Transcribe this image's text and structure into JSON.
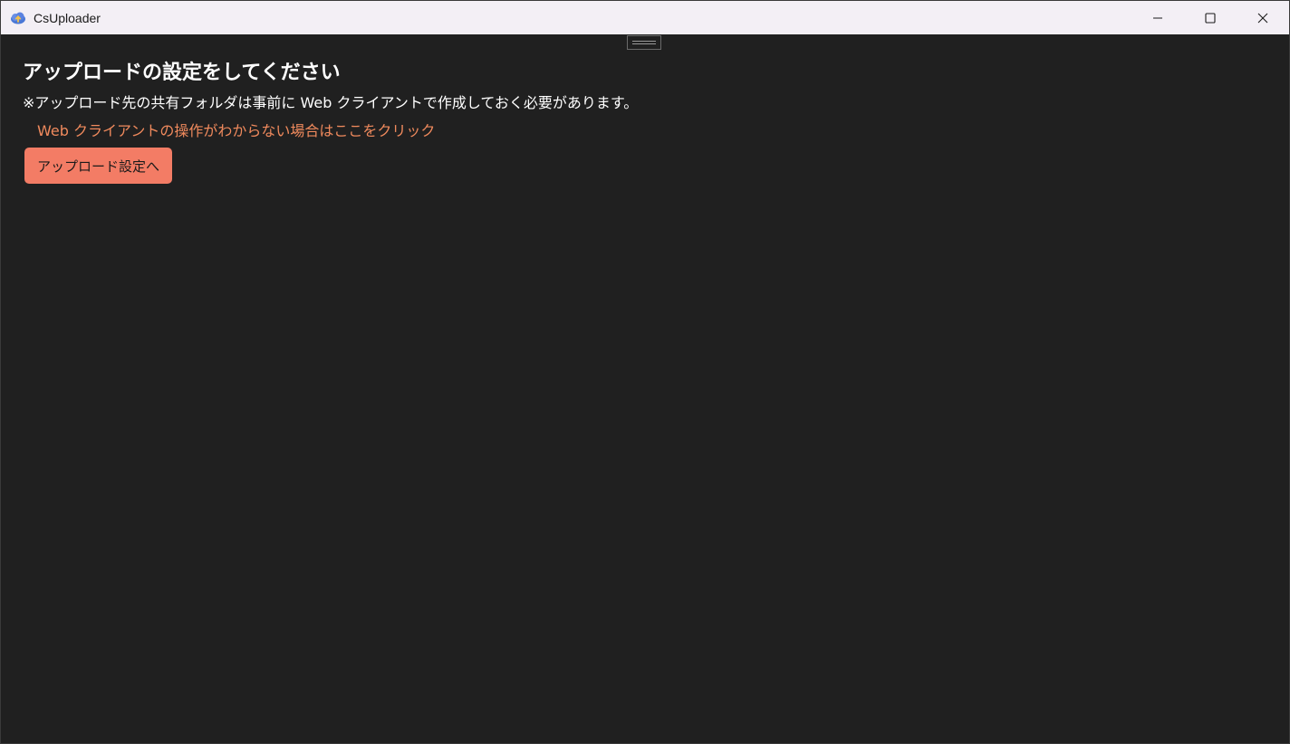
{
  "window": {
    "title": "CsUploader",
    "icon": "cloud-upload-icon",
    "controls": {
      "minimize": "minimize-icon",
      "maximize": "maximize-icon",
      "close": "close-icon"
    }
  },
  "main": {
    "heading": "アップロードの設定をしてください",
    "note": "※アップロード先の共有フォルダは事前に Web クライアントで作成しておく必要があります。",
    "help_link": "Web クライアントの操作がわからない場合はここをクリック",
    "settings_button": "アップロード設定へ"
  },
  "colors": {
    "background": "#202020",
    "titlebar": "#f3eff5",
    "accent_button": "#f37c65",
    "link": "#f08a5d",
    "text": "#ffffff"
  }
}
